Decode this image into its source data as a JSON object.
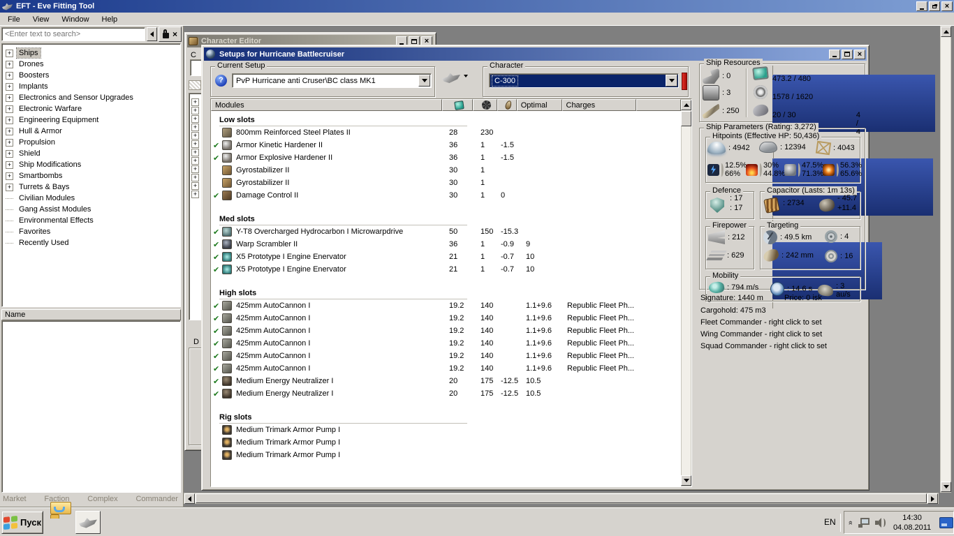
{
  "app": {
    "title": "EFT - Eve Fitting Tool",
    "menu": [
      "File",
      "View",
      "Window",
      "Help"
    ]
  },
  "sidebar": {
    "search_placeholder": "<Enter text to search>",
    "tree": [
      {
        "label": "Ships",
        "expandable": true,
        "selected": true
      },
      {
        "label": "Drones",
        "expandable": true
      },
      {
        "label": "Boosters",
        "expandable": true
      },
      {
        "label": "Implants",
        "expandable": true
      },
      {
        "label": "Electronics and Sensor Upgrades",
        "expandable": true
      },
      {
        "label": "Electronic Warfare",
        "expandable": true
      },
      {
        "label": "Engineering Equipment",
        "expandable": true
      },
      {
        "label": "Hull & Armor",
        "expandable": true
      },
      {
        "label": "Propulsion",
        "expandable": true
      },
      {
        "label": "Shield",
        "expandable": true
      },
      {
        "label": "Ship Modifications",
        "expandable": true
      },
      {
        "label": "Smartbombs",
        "expandable": true
      },
      {
        "label": "Turrets & Bays",
        "expandable": true
      },
      {
        "label": "Civilian Modules",
        "expandable": false
      },
      {
        "label": "Gang Assist Modules",
        "expandable": false
      },
      {
        "label": "Environmental Effects",
        "expandable": false
      },
      {
        "label": "Favorites",
        "expandable": false
      },
      {
        "label": "Recently Used",
        "expandable": false
      }
    ],
    "list_header": "Name",
    "tabs": [
      "Market",
      "Faction",
      "Complex",
      "Commander"
    ]
  },
  "character_editor": {
    "title": "Character Editor",
    "stub_label_c": "C",
    "stub_label_d": "D",
    "plus_boxes": 12
  },
  "setups": {
    "title": "Setups for Hurricane Battlecruiser",
    "current_setup": {
      "label": "Current Setup",
      "value": "PvP Hurricane anti Cruser\\BC class MK1"
    },
    "character": {
      "label": "Character",
      "value": "C-300"
    },
    "table": {
      "col_modules": "Modules",
      "col_optimal": "Optimal",
      "col_charges": "Charges",
      "sections": [
        {
          "name": "Low slots",
          "rows": [
            {
              "checked": false,
              "icon": "armor-plate-icon",
              "name": "800mm Reinforced Steel Plates II",
              "cpu": "28",
              "pg": "230",
              "cap": "",
              "optimal": "",
              "charges": ""
            },
            {
              "checked": true,
              "icon": "hardener-icon",
              "name": "Armor Kinetic Hardener II",
              "cpu": "36",
              "pg": "1",
              "cap": "-1.5",
              "optimal": "",
              "charges": ""
            },
            {
              "checked": true,
              "icon": "hardener-icon",
              "name": "Armor Explosive Hardener II",
              "cpu": "36",
              "pg": "1",
              "cap": "-1.5",
              "optimal": "",
              "charges": ""
            },
            {
              "checked": false,
              "icon": "gyrostabilizer-icon",
              "name": "Gyrostabilizer II",
              "cpu": "30",
              "pg": "1",
              "cap": "",
              "optimal": "",
              "charges": ""
            },
            {
              "checked": false,
              "icon": "gyrostabilizer-icon",
              "name": "Gyrostabilizer II",
              "cpu": "30",
              "pg": "1",
              "cap": "",
              "optimal": "",
              "charges": ""
            },
            {
              "checked": true,
              "icon": "damage-control-icon",
              "name": "Damage Control II",
              "cpu": "30",
              "pg": "1",
              "cap": "0",
              "optimal": "",
              "charges": ""
            }
          ]
        },
        {
          "name": "Med slots",
          "rows": [
            {
              "checked": true,
              "icon": "mwd-icon",
              "name": "Y-T8 Overcharged Hydrocarbon I Microwarpdrive",
              "cpu": "50",
              "pg": "150",
              "cap": "-15.3",
              "optimal": "",
              "charges": ""
            },
            {
              "checked": true,
              "icon": "scrambler-icon",
              "name": "Warp Scrambler II",
              "cpu": "36",
              "pg": "1",
              "cap": "-0.9",
              "optimal": "9",
              "charges": ""
            },
            {
              "checked": true,
              "icon": "webifier-icon",
              "name": "X5 Prototype I Engine Enervator",
              "cpu": "21",
              "pg": "1",
              "cap": "-0.7",
              "optimal": "10",
              "charges": ""
            },
            {
              "checked": true,
              "icon": "webifier-icon",
              "name": "X5 Prototype I Engine Enervator",
              "cpu": "21",
              "pg": "1",
              "cap": "-0.7",
              "optimal": "10",
              "charges": ""
            }
          ]
        },
        {
          "name": "High slots",
          "rows": [
            {
              "checked": true,
              "icon": "autocannon-icon",
              "name": "425mm AutoCannon I",
              "cpu": "19.2",
              "pg": "140",
              "cap": "",
              "optimal": "1.1+9.6",
              "charges": "Republic Fleet Ph..."
            },
            {
              "checked": true,
              "icon": "autocannon-icon",
              "name": "425mm AutoCannon I",
              "cpu": "19.2",
              "pg": "140",
              "cap": "",
              "optimal": "1.1+9.6",
              "charges": "Republic Fleet Ph..."
            },
            {
              "checked": true,
              "icon": "autocannon-icon",
              "name": "425mm AutoCannon I",
              "cpu": "19.2",
              "pg": "140",
              "cap": "",
              "optimal": "1.1+9.6",
              "charges": "Republic Fleet Ph..."
            },
            {
              "checked": true,
              "icon": "autocannon-icon",
              "name": "425mm AutoCannon I",
              "cpu": "19.2",
              "pg": "140",
              "cap": "",
              "optimal": "1.1+9.6",
              "charges": "Republic Fleet Ph..."
            },
            {
              "checked": true,
              "icon": "autocannon-icon",
              "name": "425mm AutoCannon I",
              "cpu": "19.2",
              "pg": "140",
              "cap": "",
              "optimal": "1.1+9.6",
              "charges": "Republic Fleet Ph..."
            },
            {
              "checked": true,
              "icon": "autocannon-icon",
              "name": "425mm AutoCannon I",
              "cpu": "19.2",
              "pg": "140",
              "cap": "",
              "optimal": "1.1+9.6",
              "charges": "Republic Fleet Ph..."
            },
            {
              "checked": true,
              "icon": "neutralizer-icon",
              "name": "Medium Energy Neutralizer I",
              "cpu": "20",
              "pg": "175",
              "cap": "-12.5",
              "optimal": "10.5",
              "charges": ""
            },
            {
              "checked": true,
              "icon": "neutralizer-icon",
              "name": "Medium Energy Neutralizer I",
              "cpu": "20",
              "pg": "175",
              "cap": "-12.5",
              "optimal": "10.5",
              "charges": ""
            }
          ]
        },
        {
          "name": "Rig slots",
          "rows": [
            {
              "checked": false,
              "icon": "rig-icon",
              "name": "Medium Trimark Armor Pump I",
              "cpu": "",
              "pg": "",
              "cap": "",
              "optimal": "",
              "charges": ""
            },
            {
              "checked": false,
              "icon": "rig-icon",
              "name": "Medium Trimark Armor Pump I",
              "cpu": "",
              "pg": "",
              "cap": "",
              "optimal": "",
              "charges": ""
            },
            {
              "checked": false,
              "icon": "rig-icon",
              "name": "Medium Trimark Armor Pump I",
              "cpu": "",
              "pg": "",
              "cap": "",
              "optimal": "",
              "charges": ""
            }
          ]
        }
      ]
    }
  },
  "stats": {
    "resources": {
      "label": "Ship Resources",
      "turrets": "0",
      "launchers": "3",
      "calibration": "250",
      "cpu_text": "473.2 / 480",
      "cpu_pct": 98.6,
      "pg_text": "1578 / 1620",
      "pg_pct": 97.4,
      "drone_text": "20 / 30",
      "drone_pct": 66.7,
      "bandwidth": "4 / 4"
    },
    "parameters_label": "Ship Parameters (Rating: 3,272)",
    "hitpoints": {
      "label": "Hitpoints (Effective HP: 50,436)",
      "shield": "4942",
      "armor": "12394",
      "hull": "4043",
      "resists": [
        {
          "icon": "em-resist-icon",
          "top": "12.5%",
          "bottom": "66%"
        },
        {
          "icon": "thermal-resist-icon",
          "top": "30%",
          "bottom": "44.8%"
        },
        {
          "icon": "kinetic-resist-icon",
          "top": "47.5%",
          "bottom": "71.3%"
        },
        {
          "icon": "explosive-resist-icon",
          "top": "56.3%",
          "bottom": "65.6%"
        }
      ]
    },
    "defence": {
      "label": "Defence",
      "v1": "17",
      "v2": "17"
    },
    "capacitor": {
      "label": "Capacitor (Lasts: 1m 13s)",
      "amount": "2734",
      "drain": "- 45.7",
      "peak": "+11.4"
    },
    "firepower": {
      "label": "Firepower",
      "volley": "212",
      "dps": "629"
    },
    "targeting": {
      "label": "Targeting",
      "range": "49.5 km",
      "max_targets": "4",
      "scan_res": "242 mm",
      "sensor_str": "16"
    },
    "mobility": {
      "label": "Mobility",
      "speed": "794 m/s",
      "align": "14.6 s",
      "warp": "3 au/s"
    },
    "footer": {
      "signature": "Signature: 1440 m",
      "price": "Price: 0 isk",
      "cargohold": "Cargohold: 475 m3",
      "fleet": "Fleet Commander - right click to set",
      "wing": "Wing Commander - right click to set",
      "squad": "Squad Commander - right click to set"
    }
  },
  "taskbar": {
    "start": "Пуск",
    "lang": "EN",
    "time": "14:30",
    "date": "04.08.2011"
  }
}
